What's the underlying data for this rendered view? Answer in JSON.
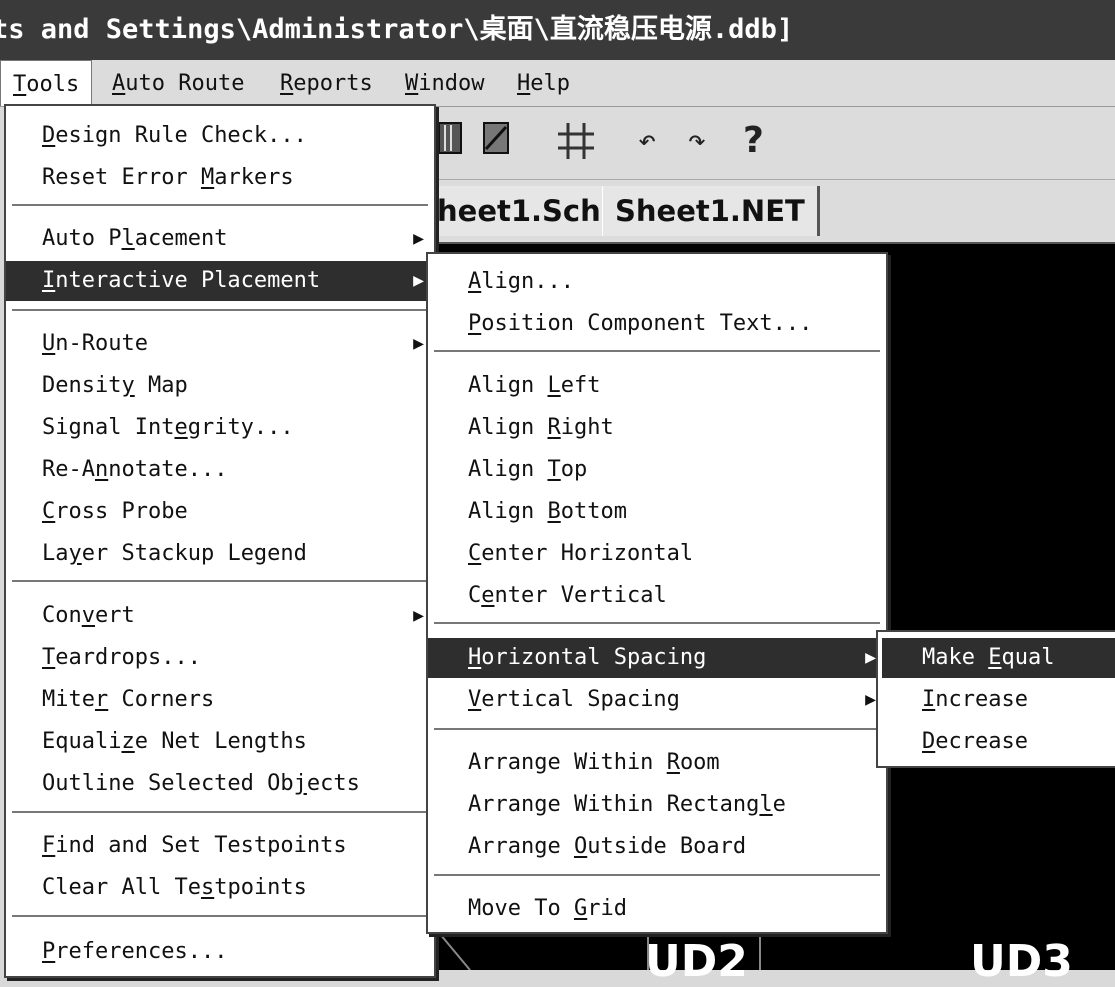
{
  "window": {
    "title": "ts and Settings\\Administrator\\桌面\\直流稳压电源.ddb]"
  },
  "menubar": [
    {
      "label": "Tools",
      "ul": "T",
      "rest": "ools",
      "active": true
    },
    {
      "label": "Auto Route",
      "ul": "A",
      "rest": "uto Route"
    },
    {
      "label": "Reports",
      "ul": "R",
      "rest": "eports"
    },
    {
      "label": "Window",
      "ul": "W",
      "rest": "indow"
    },
    {
      "label": "Help",
      "ul": "H",
      "rest": "elp"
    }
  ],
  "toolbar": {
    "icons": [
      "book-icon",
      "book-icon",
      "grid-icon",
      "undo-icon",
      "redo-icon",
      "help-icon"
    ]
  },
  "tabs": [
    "heet1.Sch",
    "Sheet1.NET"
  ],
  "canvas": {
    "labels": [
      "UD2",
      "UD3"
    ]
  },
  "tools_menu": {
    "items": [
      {
        "pre": "",
        "ul": "D",
        "post": "esign Rule Check..."
      },
      {
        "pre": "Reset Error ",
        "ul": "M",
        "post": "arkers"
      },
      {
        "pre": "Auto P",
        "ul": "l",
        "post": "acement",
        "submenu": true
      },
      {
        "pre": "",
        "ul": "I",
        "post": "nteractive Placement",
        "submenu": true,
        "selected": true
      },
      {
        "pre": "",
        "ul": "U",
        "post": "n-Route",
        "submenu": true
      },
      {
        "pre": "Densit",
        "ul": "y",
        "post": " Map"
      },
      {
        "pre": "Signal Int",
        "ul": "e",
        "post": "grity..."
      },
      {
        "pre": "Re-A",
        "ul": "n",
        "post": "notate..."
      },
      {
        "pre": "",
        "ul": "C",
        "post": "ross Probe"
      },
      {
        "pre": "La",
        "ul": "y",
        "post": "er Stackup Legend"
      },
      {
        "pre": "Con",
        "ul": "v",
        "post": "ert",
        "submenu": true
      },
      {
        "pre": "",
        "ul": "T",
        "post": "eardrops..."
      },
      {
        "pre": "Mite",
        "ul": "r",
        "post": " Corners"
      },
      {
        "pre": "Equali",
        "ul": "z",
        "post": "e Net Lengths"
      },
      {
        "pre": "Outline Selected Ob",
        "ul": "j",
        "post": "ects"
      },
      {
        "pre": "",
        "ul": "F",
        "post": "ind and Set Testpoints"
      },
      {
        "pre": "Clear All Te",
        "ul": "s",
        "post": "tpoints"
      },
      {
        "pre": "",
        "ul": "P",
        "post": "references..."
      }
    ]
  },
  "interactive_menu": {
    "items": [
      {
        "pre": "",
        "ul": "A",
        "post": "lign..."
      },
      {
        "pre": "",
        "ul": "P",
        "post": "osition Component Text..."
      },
      {
        "pre": "Align ",
        "ul": "L",
        "post": "eft"
      },
      {
        "pre": "Align ",
        "ul": "R",
        "post": "ight"
      },
      {
        "pre": "Align ",
        "ul": "T",
        "post": "op"
      },
      {
        "pre": "Align ",
        "ul": "B",
        "post": "ottom"
      },
      {
        "pre": "",
        "ul": "C",
        "post": "enter Horizontal"
      },
      {
        "pre": "C",
        "ul": "e",
        "post": "nter Vertical"
      },
      {
        "pre": "",
        "ul": "H",
        "post": "orizontal Spacing",
        "submenu": true,
        "selected": true
      },
      {
        "pre": "",
        "ul": "V",
        "post": "ertical Spacing",
        "submenu": true
      },
      {
        "pre": "Arrange Within ",
        "ul": "R",
        "post": "oom"
      },
      {
        "pre": "Arrange Within Rectang",
        "ul": "l",
        "post": "e"
      },
      {
        "pre": "Arrange ",
        "ul": "O",
        "post": "utside Board"
      },
      {
        "pre": "Move To ",
        "ul": "G",
        "post": "rid"
      }
    ]
  },
  "spacing_menu": {
    "items": [
      {
        "pre": "Make ",
        "ul": "E",
        "post": "qual",
        "selected": true
      },
      {
        "pre": "",
        "ul": "I",
        "post": "ncrease"
      },
      {
        "pre": "",
        "ul": "D",
        "post": "ecrease"
      }
    ]
  }
}
